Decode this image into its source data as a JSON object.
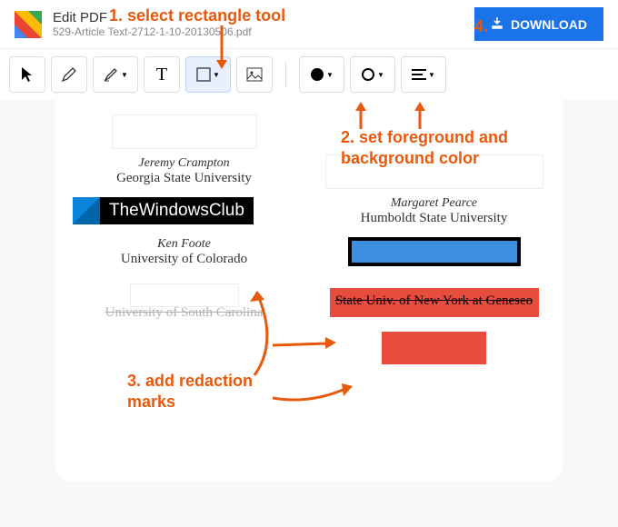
{
  "header": {
    "title": "Edit PDF",
    "filename": "529-Article Text-2712-1-10-20130506.pdf",
    "download_label": "DOWNLOAD"
  },
  "toolbar": {
    "cursor": "cursor-tool",
    "pencil": "pencil-tool",
    "highlighter": "highlighter-tool",
    "text": "T",
    "rectangle": "rectangle-tool",
    "image": "image-tool",
    "fill": "fill-color",
    "stroke": "stroke-color",
    "align": "align-tool"
  },
  "document": {
    "left_col": {
      "author1_name": "Jeremy Crampton",
      "author1_uni": "Georgia State University",
      "twc_label": "TheWindowsClub",
      "author2_name": "Ken Foote",
      "author2_uni": "University of Colorado",
      "partial": "University of South Carolina"
    },
    "right_col": {
      "author1_name": "Margaret Pearce",
      "author1_uni": "Humboldt State University",
      "partial": "State Univ. of New York at Geneseo"
    }
  },
  "annotations": {
    "a1": "1. select rectangle tool",
    "a2": "2. set foreground and background color",
    "a3": "3. add redaction marks",
    "a4": "4."
  }
}
